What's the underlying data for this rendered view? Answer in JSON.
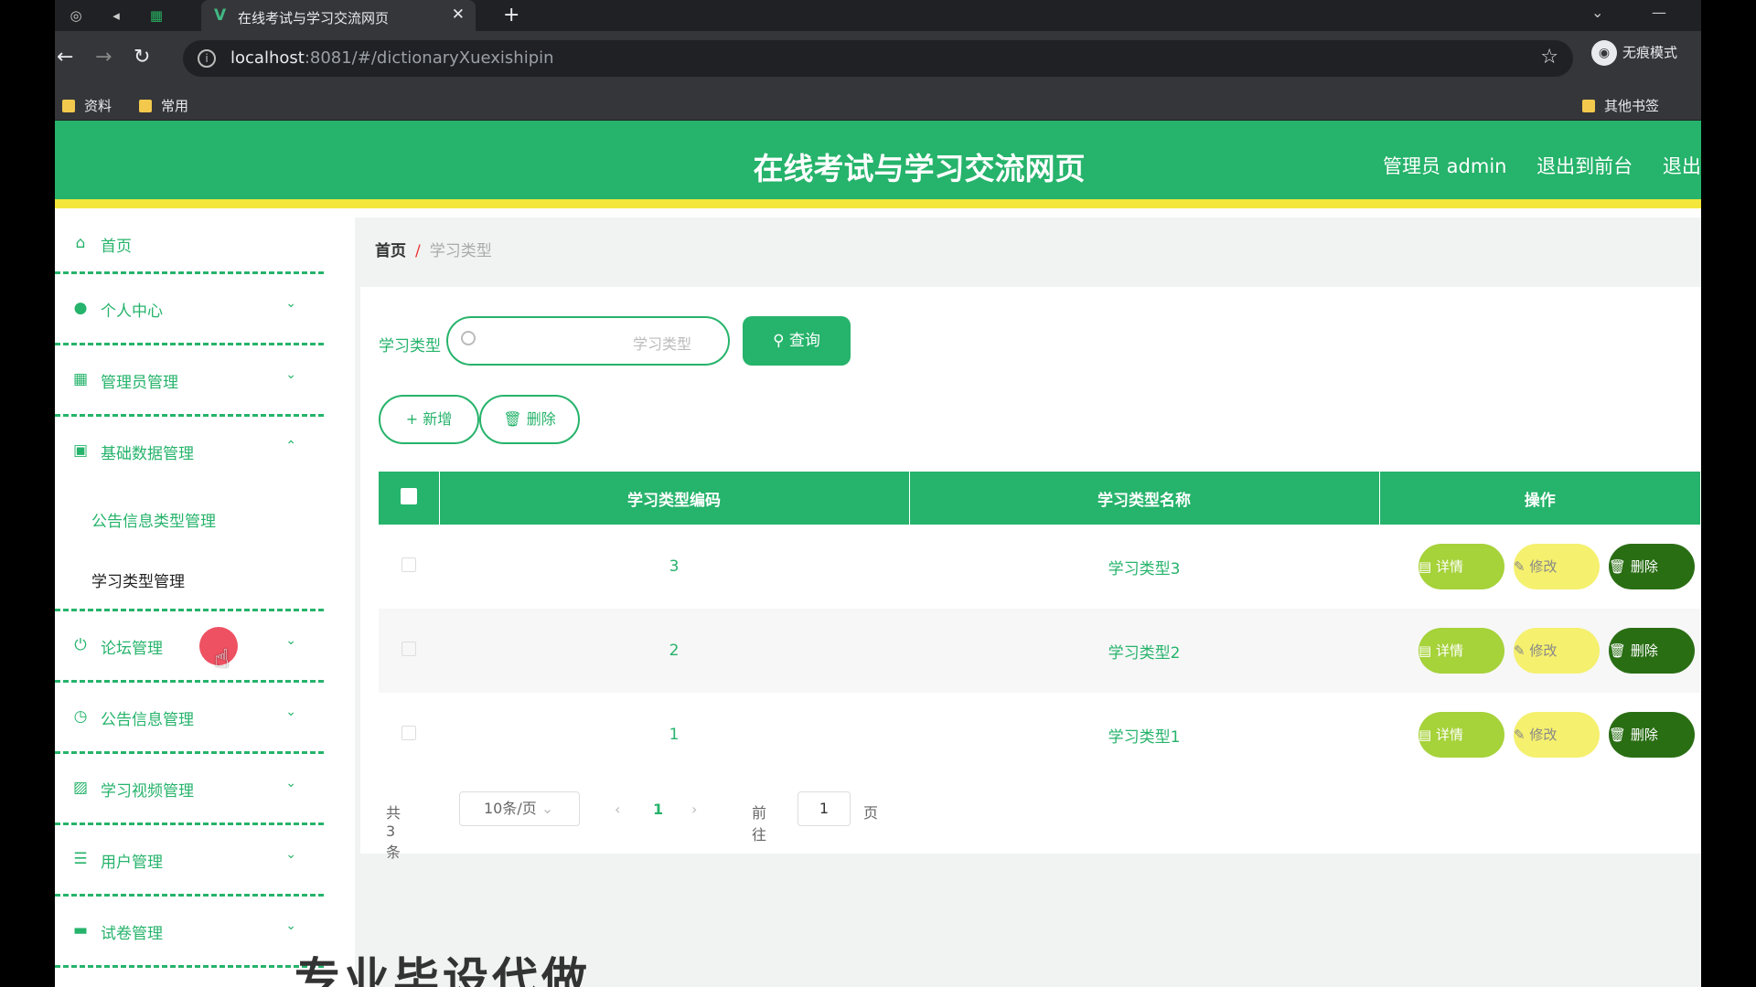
{
  "browser": {
    "tab_title": "在线考试与学习交流网页",
    "url_host": "localhost",
    "url_path": ":8081/#/dictionaryXuexishipin",
    "incognito_label": "无痕模式",
    "bookmarks": [
      "资料",
      "常用"
    ],
    "other_bookmarks": "其他书签"
  },
  "header": {
    "title": "在线考试与学习交流网页",
    "admin_label": "管理员 admin",
    "front_link": "退出到前台",
    "logout_link": "退出"
  },
  "sidebar": {
    "home": "首页",
    "personal": "个人中心",
    "admin_mgmt": "管理员管理",
    "basic_data": "基础数据管理",
    "sub_notice_type": "公告信息类型管理",
    "sub_study_type": "学习类型管理",
    "forum": "论坛管理",
    "notice": "公告信息管理",
    "video": "学习视频管理",
    "user": "用户管理",
    "paper": "试卷管理"
  },
  "breadcrumb": {
    "home": "首页",
    "sep": "/",
    "current": "学习类型"
  },
  "search": {
    "label": "学习类型",
    "placeholder": "学习类型",
    "button": "查询"
  },
  "actions": {
    "add": "新增",
    "delete": "删除"
  },
  "table": {
    "headers": [
      "学习类型编码",
      "学习类型名称",
      "操作"
    ],
    "rows": [
      {
        "code": "3",
        "name": "学习类型3"
      },
      {
        "code": "2",
        "name": "学习类型2"
      },
      {
        "code": "1",
        "name": "学习类型1"
      }
    ],
    "ops": {
      "detail": "详情",
      "edit": "修改",
      "delete": "删除"
    }
  },
  "pagination": {
    "total": "共 3 条",
    "page_size": "10条/页",
    "current": "1",
    "goto_label": "前往",
    "goto_value": "1",
    "page_suffix": "页"
  },
  "watermark": "专业毕设代做",
  "colors": {
    "primary": "#26b36b",
    "accent_bar": "#f2e73a",
    "detail": "#a6d23a",
    "edit": "#f5f06e",
    "delete": "#2a6e14"
  }
}
